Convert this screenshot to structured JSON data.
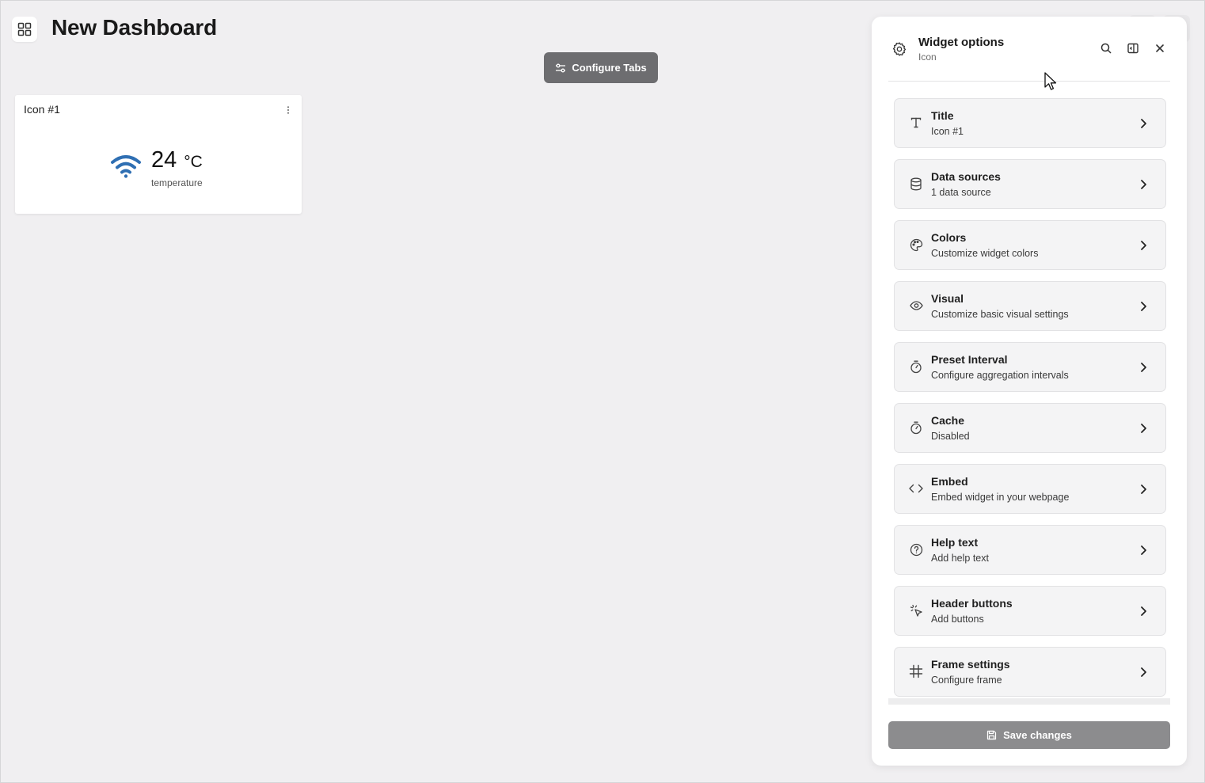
{
  "header": {
    "title": "New Dashboard",
    "apps_icon": "grid-icon",
    "configure_tabs_label": "Configure Tabs",
    "configure_tabs_icon": "sliders-icon"
  },
  "widget": {
    "title": "Icon #1",
    "value": "24",
    "unit": "°C",
    "label": "temperature",
    "icon": "wifi-icon",
    "icon_color": "#2f6fb3"
  },
  "panel": {
    "title": "Widget options",
    "subtitle": "Icon",
    "options": [
      {
        "label": "Title",
        "description": "Icon #1",
        "icon": "type-icon"
      },
      {
        "label": "Data sources",
        "description": "1 data source",
        "icon": "database-icon"
      },
      {
        "label": "Colors",
        "description": "Customize widget colors",
        "icon": "palette-icon"
      },
      {
        "label": "Visual",
        "description": "Customize basic visual settings",
        "icon": "eye-icon"
      },
      {
        "label": "Preset Interval",
        "description": "Configure aggregation intervals",
        "icon": "timer-icon"
      },
      {
        "label": "Cache",
        "description": "Disabled",
        "icon": "timer-icon"
      },
      {
        "label": "Embed",
        "description": "Embed widget in your webpage",
        "icon": "code-icon"
      },
      {
        "label": "Help text",
        "description": "Add help text",
        "icon": "help-circle-icon"
      },
      {
        "label": "Header buttons",
        "description": "Add buttons",
        "icon": "pointer-click-icon"
      },
      {
        "label": "Frame settings",
        "description": "Configure frame",
        "icon": "hash-icon"
      }
    ],
    "save_label": "Save changes"
  }
}
